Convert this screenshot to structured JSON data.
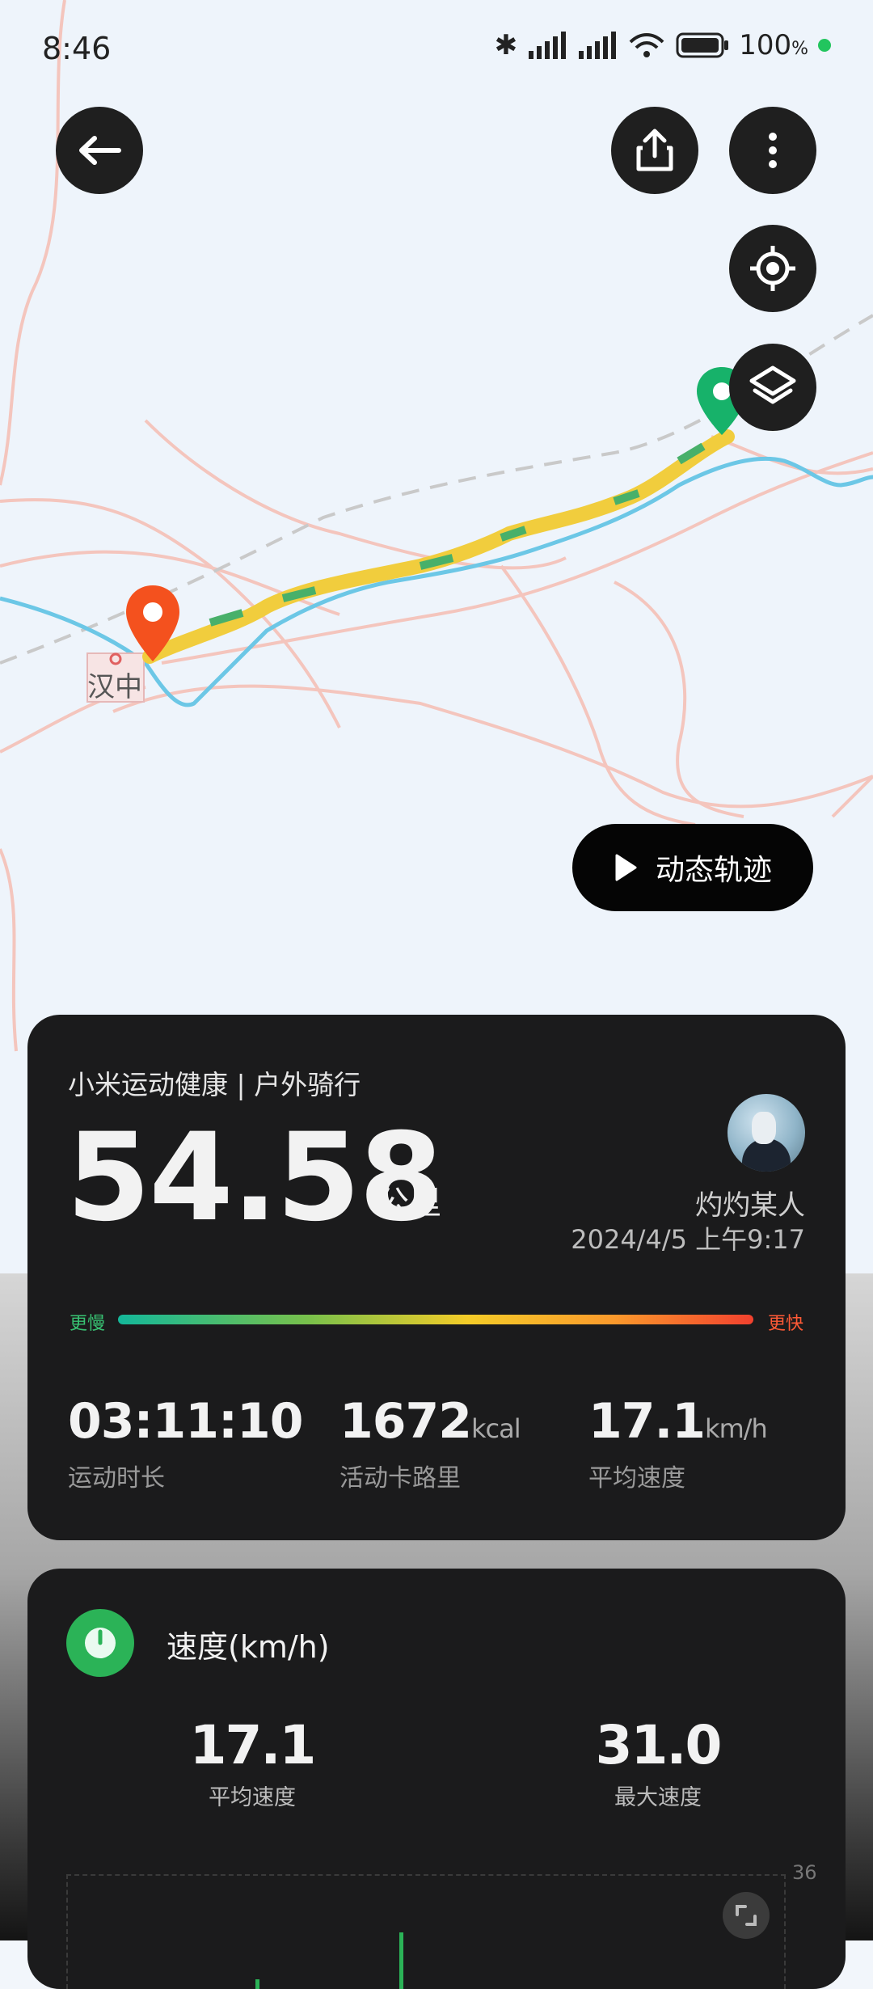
{
  "status_bar": {
    "time": "8:46",
    "battery": "100",
    "battery_unit": "%"
  },
  "map": {
    "city_label": "汉中",
    "play_button_label": "动态轨迹"
  },
  "summary": {
    "app_and_activity": "小米运动健康 | 户外骑行",
    "distance_value": "54.58",
    "distance_unit": "公里",
    "user_name": "灼灼某人",
    "date_time": "2024/4/5 上午9:17",
    "legend_slow": "更慢",
    "legend_fast": "更快",
    "stats": [
      {
        "value": "03:11:10",
        "unit": "",
        "label": "运动时长"
      },
      {
        "value": "1672",
        "unit": "kcal",
        "label": "活动卡路里"
      },
      {
        "value": "17.1",
        "unit": "km/h",
        "label": "平均速度"
      }
    ]
  },
  "speed_card": {
    "title": "速度(km/h)",
    "avg_value": "17.1",
    "avg_label": "平均速度",
    "max_value": "31.0",
    "max_label": "最大速度",
    "chart_max_tick": "36"
  },
  "colors": {
    "card_bg": "#1b1b1c",
    "start_marker": "#f4511e",
    "end_marker": "#17b26a",
    "speed_icon": "#2bb357",
    "slow": "#38c172",
    "fast": "#ff5a36"
  },
  "icons": [
    "back-arrow-icon",
    "share-icon",
    "more-vertical-icon",
    "locate-icon",
    "layers-icon",
    "play-icon",
    "speedometer-icon",
    "expand-icon",
    "bluetooth-icon",
    "signal-icon",
    "wifi-icon",
    "battery-icon"
  ]
}
